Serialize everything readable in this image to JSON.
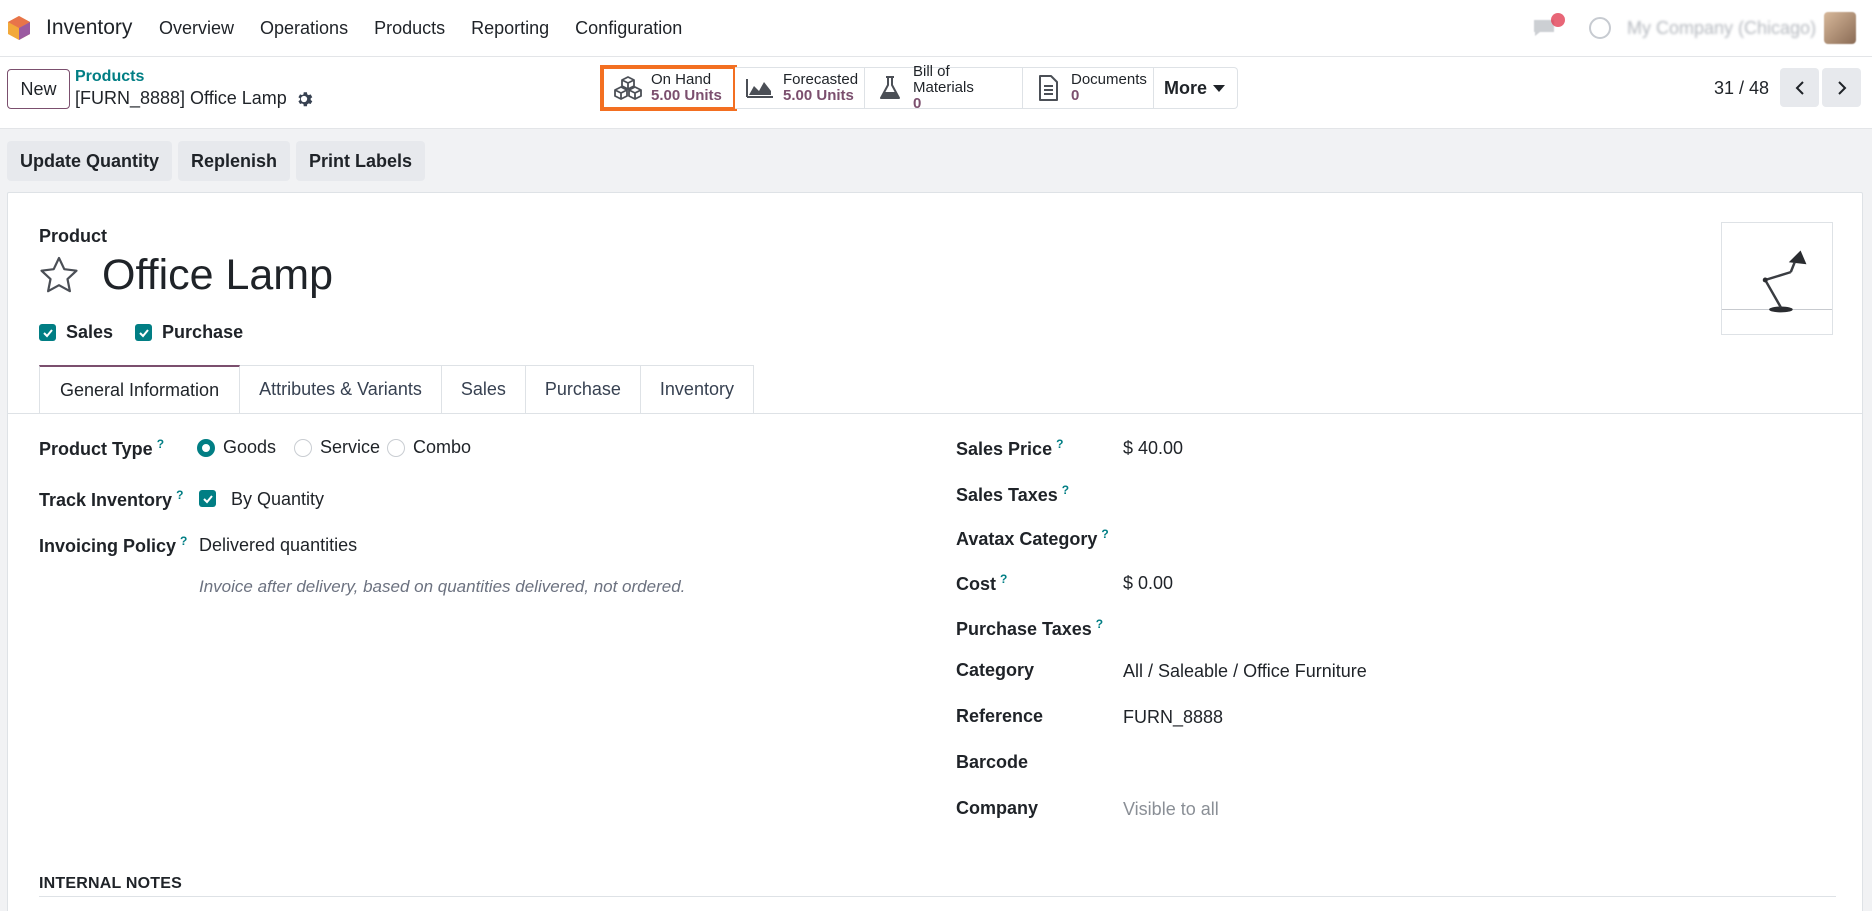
{
  "navbar": {
    "app_name": "Inventory",
    "menu": [
      "Overview",
      "Operations",
      "Products",
      "Reporting",
      "Configuration"
    ],
    "company": "My Company (Chicago)"
  },
  "control": {
    "new_label": "New",
    "breadcrumb_parent": "Products",
    "breadcrumb_current": "[FURN_8888] Office Lamp",
    "smart_buttons": {
      "on_hand": {
        "label": "On Hand",
        "value": "5.00 Units"
      },
      "forecasted": {
        "label": "Forecasted",
        "value": "5.00 Units"
      },
      "bom": {
        "label": "Bill of Materials",
        "value": "0"
      },
      "documents": {
        "label": "Documents",
        "value": "0"
      },
      "more": "More"
    },
    "pager": "31 / 48"
  },
  "actions": [
    "Update Quantity",
    "Replenish",
    "Print Labels"
  ],
  "form": {
    "product_label": "Product",
    "title": "Office Lamp",
    "checkboxes": {
      "sales": "Sales",
      "purchase": "Purchase"
    },
    "tabs": [
      "General Information",
      "Attributes & Variants",
      "Sales",
      "Purchase",
      "Inventory"
    ],
    "left": {
      "product_type_label": "Product Type",
      "product_type_options": [
        "Goods",
        "Service",
        "Combo"
      ],
      "product_type_selected": "Goods",
      "track_inventory_label": "Track Inventory",
      "track_inventory_value": "By Quantity",
      "invoicing_policy_label": "Invoicing Policy",
      "invoicing_policy_value": "Delivered quantities",
      "invoicing_policy_help": "Invoice after delivery, based on quantities delivered, not ordered."
    },
    "right": {
      "sales_price_label": "Sales Price",
      "sales_price_value": "$ 40.00",
      "sales_taxes_label": "Sales Taxes",
      "avatax_label": "Avatax Category",
      "cost_label": "Cost",
      "cost_value": "$ 0.00",
      "purchase_taxes_label": "Purchase Taxes",
      "category_label": "Category",
      "category_value": "All / Saleable / Office Furniture",
      "reference_label": "Reference",
      "reference_value": "FURN_8888",
      "barcode_label": "Barcode",
      "company_label": "Company",
      "company_value": "Visible to all"
    },
    "internal_notes": "INTERNAL NOTES",
    "help_mark": "?"
  },
  "colors": {
    "accent": "#7b4f6e",
    "teal": "#017e84",
    "highlight": "#f36f21"
  }
}
